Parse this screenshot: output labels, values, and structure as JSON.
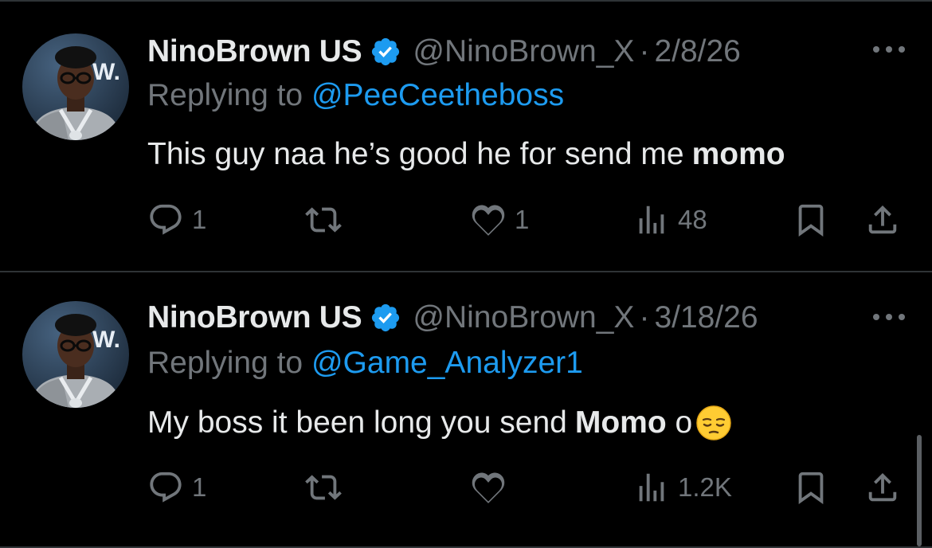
{
  "tweets": [
    {
      "name": "NinoBrown US",
      "handle": "@NinoBrown_X",
      "separator": "·",
      "date": "2/8/26",
      "reply_prefix": "Replying to ",
      "reply_to": "@PeeCeetheboss",
      "text_plain": "This guy naa he’s good he for send me",
      "text_bold": "momo",
      "text_after": "",
      "has_emoji": false,
      "replies": "1",
      "retweets": "",
      "likes": "1",
      "views": "48"
    },
    {
      "name": "NinoBrown US",
      "handle": "@NinoBrown_X",
      "separator": "·",
      "date": "3/18/26",
      "reply_prefix": "Replying to ",
      "reply_to": "@Game_Analyzer1",
      "text_plain": "My boss it been long you send",
      "text_bold": "Momo",
      "text_after": " o",
      "has_emoji": true,
      "emoji_name": "pensive-face-emoji",
      "replies": "1",
      "retweets": "",
      "likes": "",
      "views": "1.2K"
    }
  ],
  "colors": {
    "background": "#000000",
    "text": "#e7e9ea",
    "muted": "#71767b",
    "link": "#1d9bf0",
    "verified": "#1d9bf0",
    "divider": "#2f3336"
  }
}
